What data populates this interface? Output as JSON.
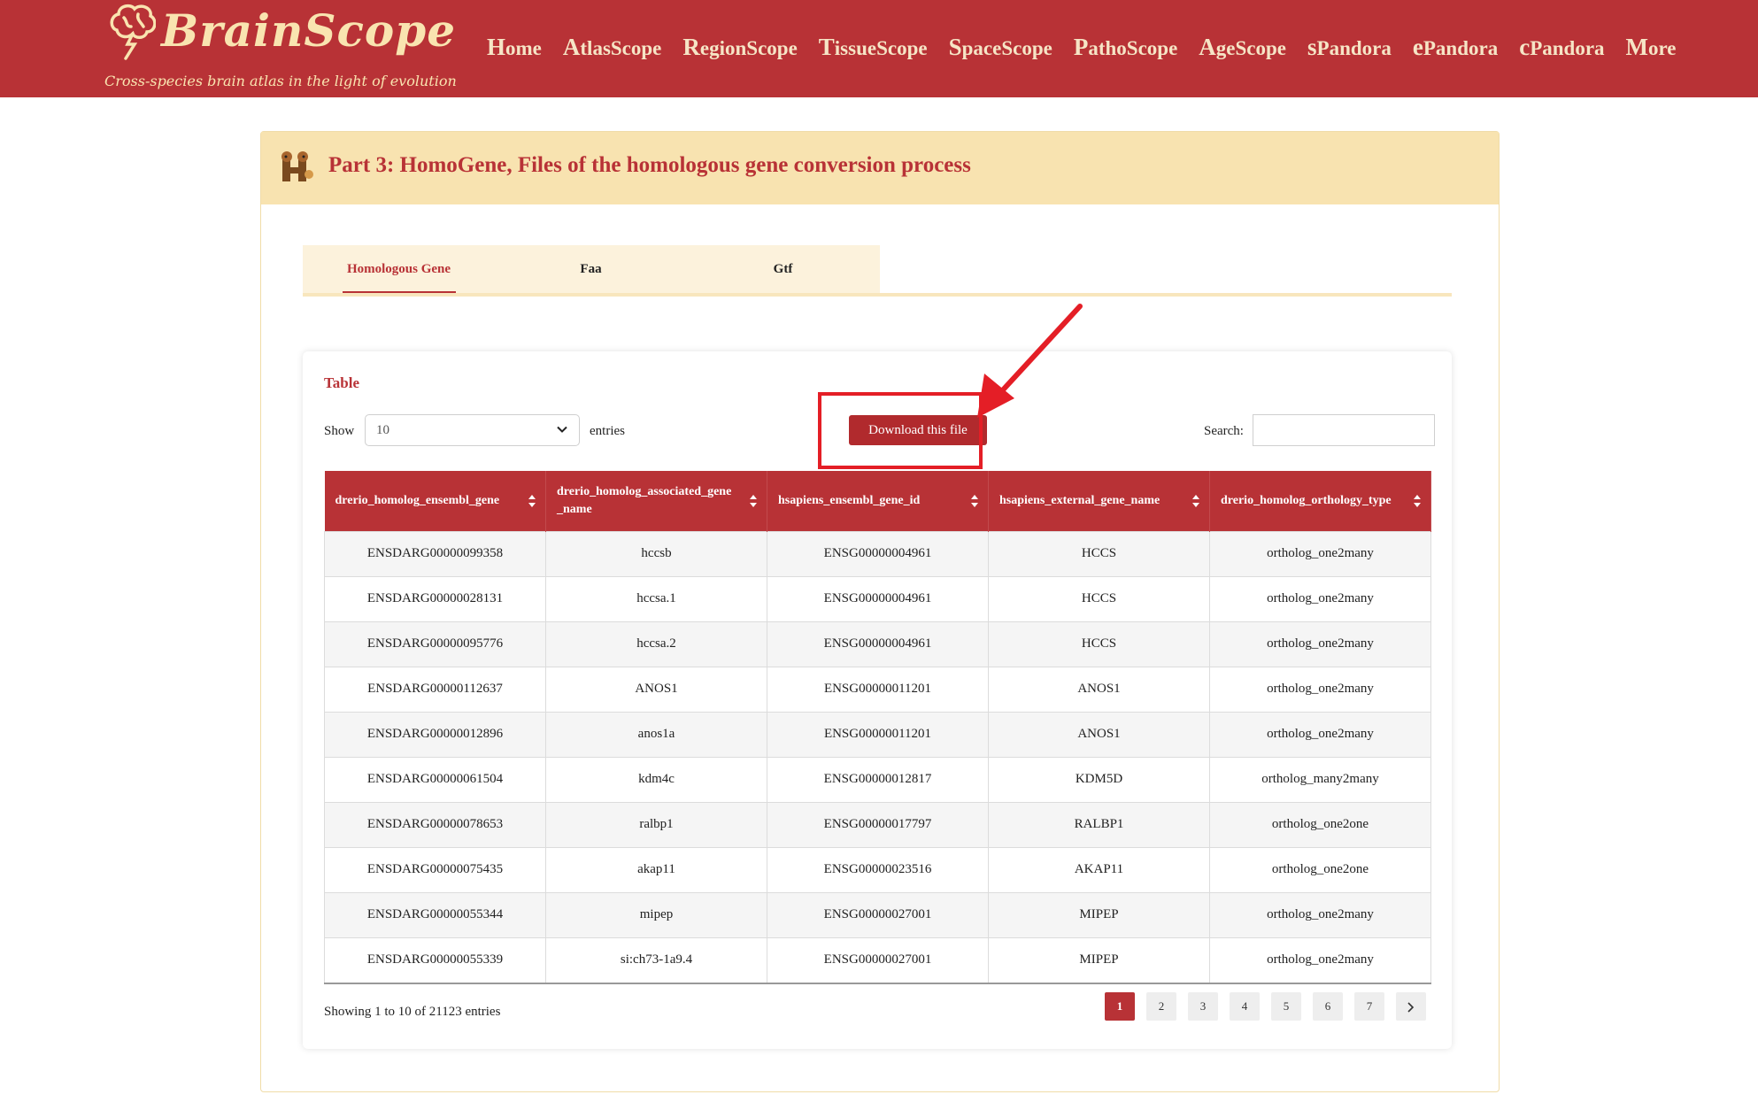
{
  "header": {
    "logo_title": "BrainScope",
    "logo_tagline": "Cross-species brain atlas in the light of evolution",
    "nav": [
      {
        "cap": "H",
        "rest": "ome"
      },
      {
        "cap": "A",
        "rest": "tlasScope"
      },
      {
        "cap": "R",
        "rest": "egionScope"
      },
      {
        "cap": "T",
        "rest": "issueScope"
      },
      {
        "cap": "S",
        "rest": "paceScope"
      },
      {
        "cap": "P",
        "rest": "athoScope"
      },
      {
        "cap": "A",
        "rest": "geScope"
      },
      {
        "cap": "s",
        "rest": "Pandora"
      },
      {
        "cap": "e",
        "rest": "Pandora"
      },
      {
        "cap": "c",
        "rest": "Pandora"
      },
      {
        "cap": "M",
        "rest": "ore"
      }
    ]
  },
  "panel": {
    "title": "Part 3: HomoGene, Files of the homologous gene conversion process",
    "icon": "homogene-logo-icon"
  },
  "tabs": [
    {
      "label": "Homologous Gene",
      "active": true
    },
    {
      "label": "Faa",
      "active": false
    },
    {
      "label": "Gtf",
      "active": false
    }
  ],
  "card": {
    "title": "Table",
    "show_label": "Show",
    "page_length": "10",
    "entries_label": "entries",
    "download_label": "Download this file",
    "search_label": "Search:",
    "search_value": ""
  },
  "table": {
    "columns": [
      "drerio_homolog_ensembl_gene",
      "drerio_homolog_associated_gene_name",
      "hsapiens_ensembl_gene_id",
      "hsapiens_external_gene_name",
      "drerio_homolog_orthology_type"
    ],
    "rows": [
      [
        "ENSDARG00000099358",
        "hccsb",
        "ENSG00000004961",
        "HCCS",
        "ortholog_one2many"
      ],
      [
        "ENSDARG00000028131",
        "hccsa.1",
        "ENSG00000004961",
        "HCCS",
        "ortholog_one2many"
      ],
      [
        "ENSDARG00000095776",
        "hccsa.2",
        "ENSG00000004961",
        "HCCS",
        "ortholog_one2many"
      ],
      [
        "ENSDARG00000112637",
        "ANOS1",
        "ENSG00000011201",
        "ANOS1",
        "ortholog_one2many"
      ],
      [
        "ENSDARG00000012896",
        "anos1a",
        "ENSG00000011201",
        "ANOS1",
        "ortholog_one2many"
      ],
      [
        "ENSDARG00000061504",
        "kdm4c",
        "ENSG00000012817",
        "KDM5D",
        "ortholog_many2many"
      ],
      [
        "ENSDARG00000078653",
        "ralbp1",
        "ENSG00000017797",
        "RALBP1",
        "ortholog_one2one"
      ],
      [
        "ENSDARG00000075435",
        "akap11",
        "ENSG00000023516",
        "AKAP11",
        "ortholog_one2one"
      ],
      [
        "ENSDARG00000055344",
        "mipep",
        "ENSG00000027001",
        "MIPEP",
        "ortholog_one2many"
      ],
      [
        "ENSDARG00000055339",
        "si:ch73-1a9.4",
        "ENSG00000027001",
        "MIPEP",
        "ortholog_one2many"
      ]
    ]
  },
  "footer": {
    "info": "Showing 1 to 10 of 21123 entries",
    "pages": [
      "1",
      "2",
      "3",
      "4",
      "5",
      "6",
      "7"
    ],
    "current_page": "1",
    "next_icon": "chevron-right-icon"
  },
  "colors": {
    "brand": "#b83236",
    "header_panel": "#f8e3b0",
    "annotation": "#e41e26"
  }
}
